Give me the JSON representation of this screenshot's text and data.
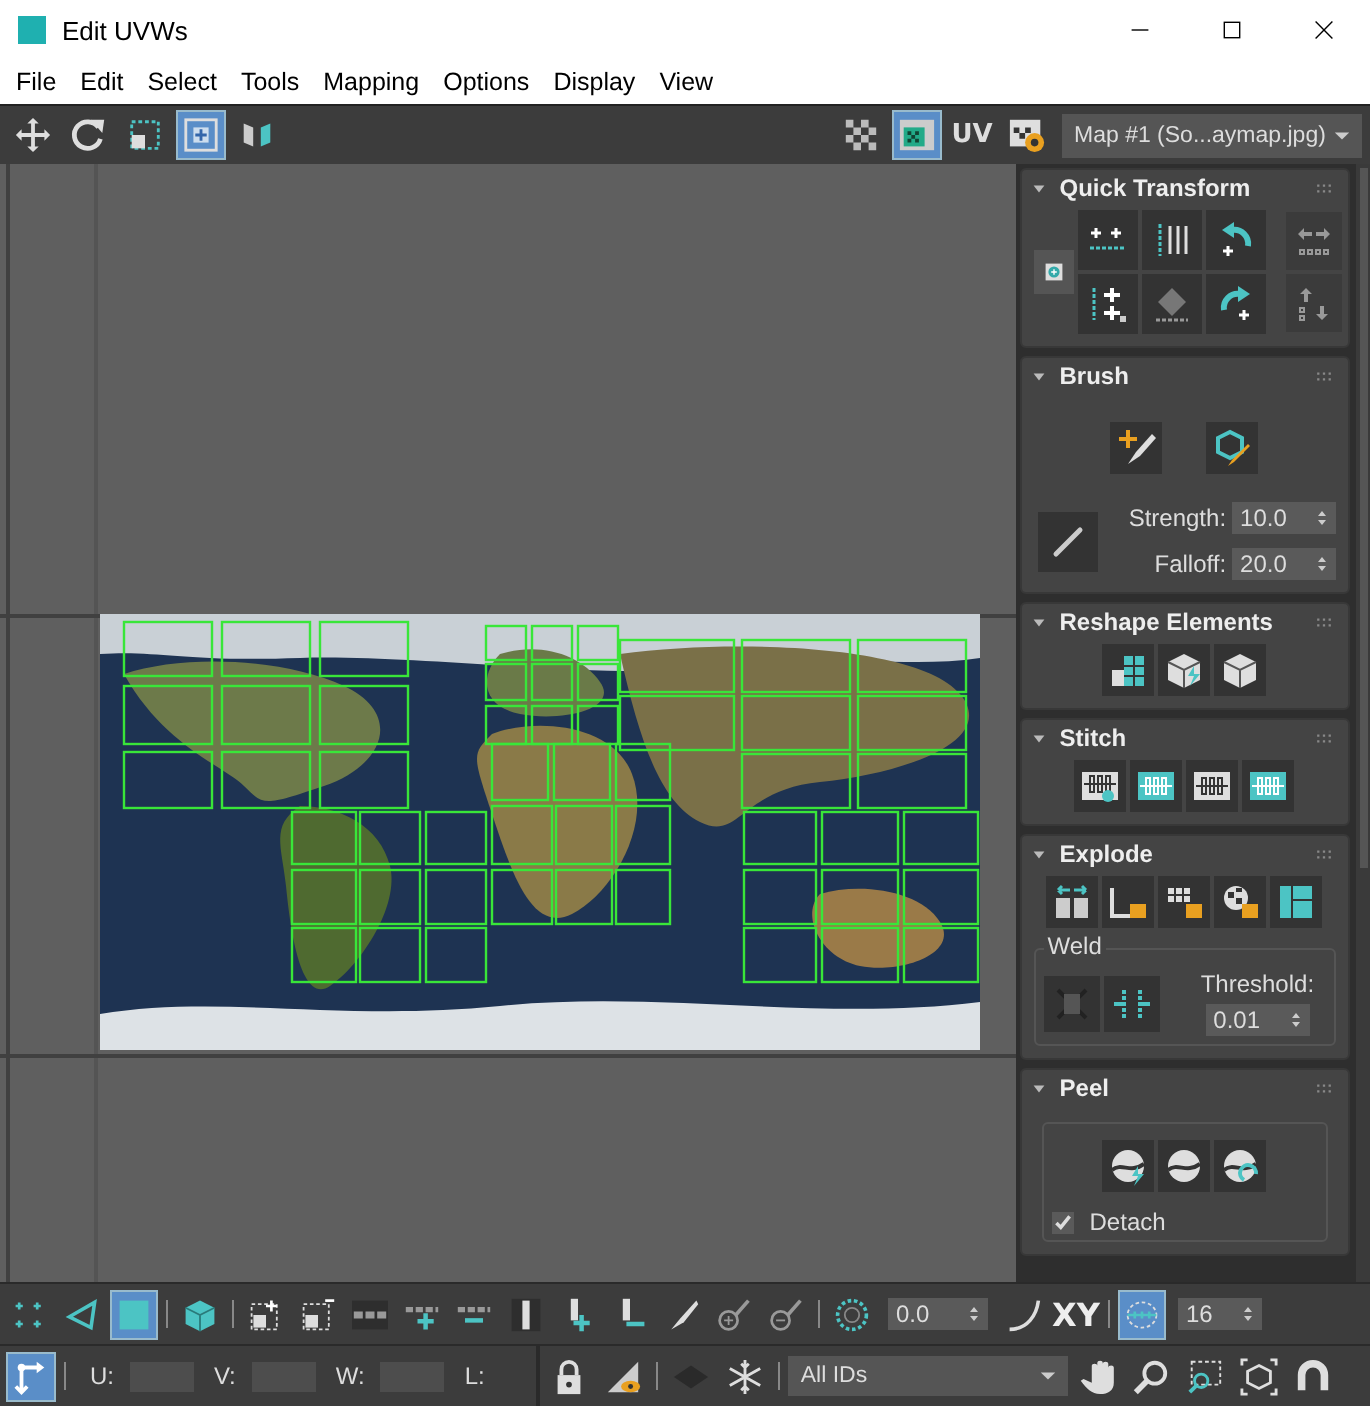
{
  "window": {
    "title": "Edit UVWs"
  },
  "menu": [
    "File",
    "Edit",
    "Select",
    "Tools",
    "Mapping",
    "Options",
    "Display",
    "View"
  ],
  "top_toolbar": {
    "tools": [
      {
        "selected": false
      },
      {
        "selected": false
      },
      {
        "selected": false
      },
      {
        "selected": true
      },
      {
        "selected": false
      }
    ],
    "texture_selected": true,
    "uv_label": "UV",
    "map_dropdown": "Map #1 (So...aymap.jpg)"
  },
  "rollouts": [
    {
      "kind": "quick_transform",
      "title": "Quick Transform",
      "expanded": true
    },
    {
      "kind": "brush",
      "title": "Brush",
      "expanded": true,
      "fields": [
        {
          "label": "Strength:",
          "value": "10.0"
        },
        {
          "label": "Falloff:",
          "value": "20.0"
        }
      ]
    },
    {
      "kind": "reshape",
      "title": "Reshape Elements",
      "expanded": true
    },
    {
      "kind": "stitch",
      "title": "Stitch",
      "expanded": true
    },
    {
      "kind": "explode",
      "title": "Explode",
      "expanded": true,
      "group": "Weld",
      "threshold_label": "Threshold:",
      "threshold": "0.01"
    },
    {
      "kind": "peel",
      "title": "Peel",
      "expanded": true,
      "detach": {
        "label": "Detach",
        "checked": true
      }
    }
  ],
  "bottom_toolbar": {
    "modes": [
      {
        "selected": false
      },
      {
        "selected": false
      },
      {
        "selected": true
      }
    ],
    "angle": "0.0",
    "axis": "XY",
    "snap_selected": true,
    "subdivisions": "16"
  },
  "status_bar": {
    "transform_selected": true,
    "fields": [
      {
        "label": "U:"
      },
      {
        "label": "V:"
      },
      {
        "label": "W:"
      }
    ],
    "lock_label": "L:",
    "id_filter": "All IDs"
  }
}
